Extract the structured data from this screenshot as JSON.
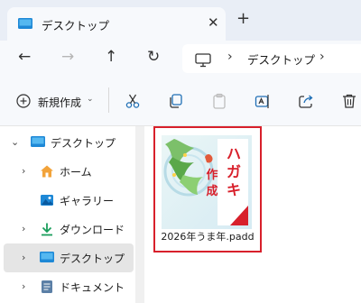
{
  "window": {
    "tab_title": "デスクトップ",
    "close_tab_glyph": "✕",
    "new_tab_glyph": "+"
  },
  "nav": {
    "back_glyph": "←",
    "forward_glyph": "→",
    "up_glyph": "↑",
    "refresh_glyph": "↻"
  },
  "address": {
    "separator": "›",
    "current": "デスクトップ"
  },
  "toolbar": {
    "new_label": "新規作成",
    "new_chevron": "⌄",
    "icons": [
      "cut-icon",
      "copy-icon",
      "paste-icon",
      "rename-icon",
      "share-icon",
      "delete-icon"
    ]
  },
  "sidebar": {
    "items": [
      {
        "label": "デスクトップ",
        "icon": "desktop-icon",
        "chevron": "⌄"
      },
      {
        "label": "ホーム",
        "icon": "home-icon",
        "chevron": "›"
      },
      {
        "label": "ギャラリー",
        "icon": "gallery-icon",
        "chevron": ""
      },
      {
        "label": "ダウンロード",
        "icon": "download-icon",
        "chevron": "›"
      },
      {
        "label": "デスクトップ",
        "icon": "desktop-icon",
        "chevron": "›"
      },
      {
        "label": "ドキュメント",
        "icon": "documents-icon",
        "chevron": "›"
      }
    ]
  },
  "files": [
    {
      "name": "2026年うま年.padd",
      "thumbnail_text": "ハガキ作成"
    }
  ],
  "colors": {
    "accent": "#d8202b",
    "selected_bg": "#e5e5e5",
    "titlebar_bg": "#e9eef6"
  }
}
